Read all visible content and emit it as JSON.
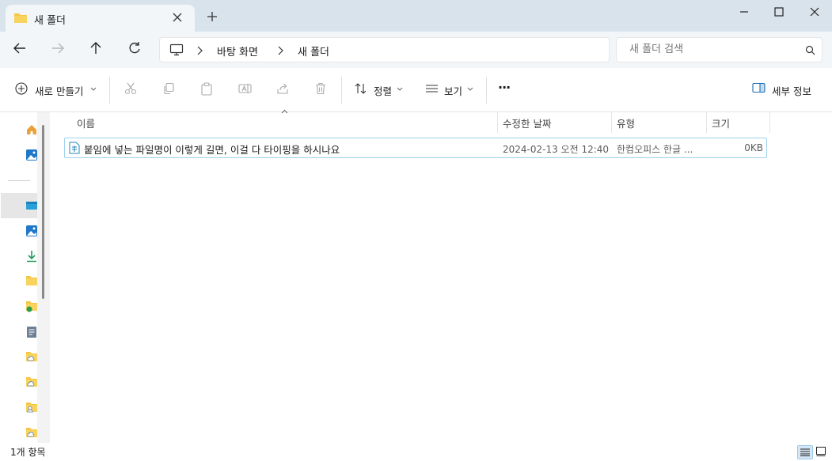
{
  "window": {
    "tab_title": "새 폴더",
    "colors": {
      "titlebar": "#d9e3ec",
      "accent_folder": "#f6c744",
      "selection_border": "#9ed2ef"
    }
  },
  "address": {
    "crumbs": [
      "바탕 화면",
      "새 폴더"
    ],
    "search_placeholder": "새 폴더 검색"
  },
  "toolbar": {
    "new_label": "새로 만들기",
    "sort_label": "정렬",
    "view_label": "보기",
    "more_label": "···",
    "details_label": "세부 정보"
  },
  "columns": {
    "name": "이름",
    "modified": "수정한 날짜",
    "type": "유형",
    "size": "크기"
  },
  "files": [
    {
      "name": "붙임에 넣는 파일명이 이렇게 길면, 이걸 다 타이핑을 하시나요",
      "modified": "2024-02-13 오전 12:40",
      "type": "한컴오피스 한글 ...",
      "size": "0KB"
    }
  ],
  "status": {
    "count": "1개 항목"
  },
  "sidebar_icons": [
    "home-icon",
    "gallery-icon",
    "desktop-icon",
    "pictures-icon",
    "downloads-icon",
    "folder-icon",
    "shared-folder-icon",
    "documents-icon",
    "cloud-folder-icon",
    "cloud-folder-icon",
    "user-folder-icon",
    "cloud-folder-icon"
  ]
}
